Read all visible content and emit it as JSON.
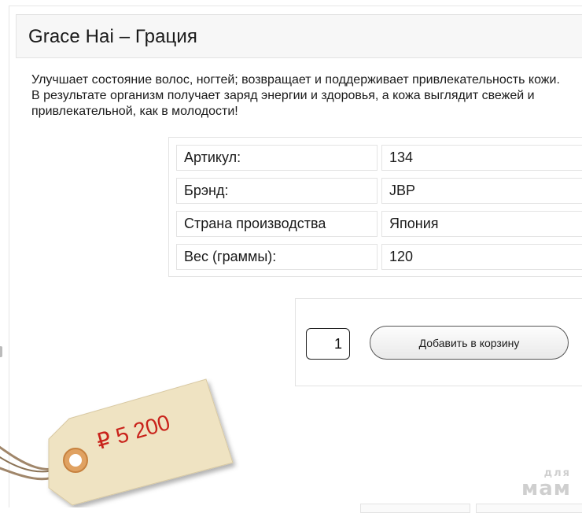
{
  "product": {
    "title": "Grace Hai – Грация",
    "description": "Улучшает состояние волос, ногтей; возвращает и поддерживает привлекательность кожи. В результате организм получает заряд энергии и здоровья, а кожа выглядит свежей и привлекательной, как в молодости!"
  },
  "specs": [
    {
      "label": "Артикул:",
      "value": "134"
    },
    {
      "label": "Брэнд:",
      "value": "JBP"
    },
    {
      "label": "Страна производства",
      "value": "Япония"
    },
    {
      "label": "Вес (граммы):",
      "value": "120"
    }
  ],
  "cart": {
    "quantity": "1",
    "add_label": "Добавить в корзину"
  },
  "price_tag": {
    "text": "₽ 5 200",
    "text_color": "#c9231b",
    "tag_color": "#efe3c2"
  },
  "watermark": {
    "top": "для",
    "bottom": "мам"
  }
}
